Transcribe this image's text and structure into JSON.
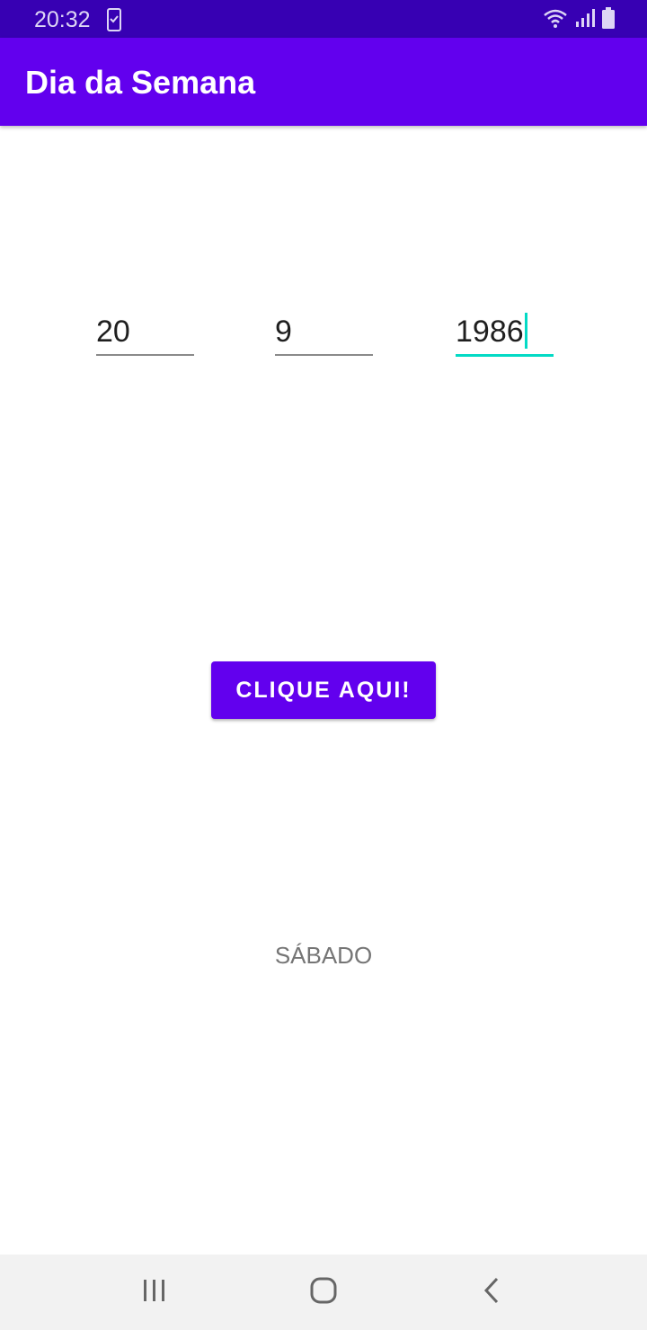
{
  "status_bar": {
    "time": "20:32",
    "icons": [
      "phone-check-icon",
      "wifi-icon",
      "signal-icon",
      "battery-icon"
    ]
  },
  "app_bar": {
    "title": "Dia da Semana"
  },
  "form": {
    "day_value": "20",
    "month_value": "9",
    "year_value": "1986",
    "focused_field": "year"
  },
  "button": {
    "label": "CLIQUE AQUI!"
  },
  "result": {
    "text": "SÁBADO"
  },
  "nav_bar": {
    "icons": [
      "recents-icon",
      "home-icon",
      "back-icon"
    ]
  },
  "colors": {
    "primary": "#6200ee",
    "primary_dark": "#3700b3",
    "accent": "#03dac5",
    "result_text": "#757575"
  }
}
